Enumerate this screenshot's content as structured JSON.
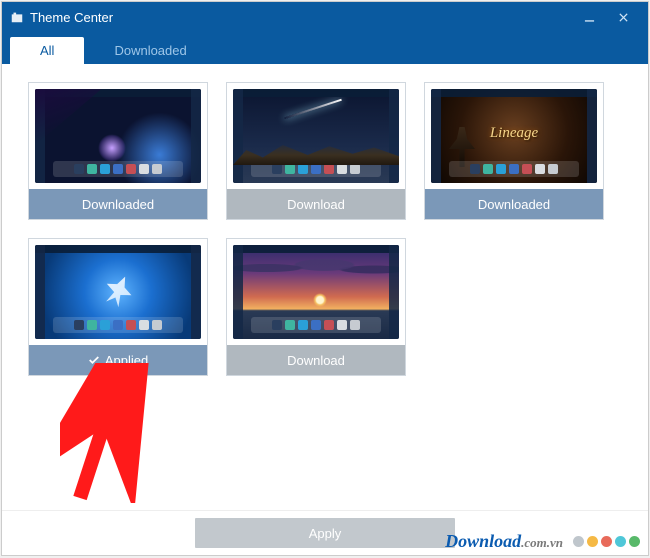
{
  "window": {
    "title": "Theme Center"
  },
  "tabs": {
    "all": "All",
    "downloaded": "Downloaded",
    "active": "all"
  },
  "themes": [
    {
      "status_label": "Downloaded",
      "status_kind": "downloaded",
      "wallpaper": "galaxy"
    },
    {
      "status_label": "Download",
      "status_kind": "download",
      "wallpaper": "comet"
    },
    {
      "status_label": "Downloaded",
      "status_kind": "downloaded",
      "wallpaper": "lineage",
      "logo_text": "Lineage"
    },
    {
      "status_label": "Applied",
      "status_kind": "applied",
      "wallpaper": "feather"
    },
    {
      "status_label": "Download",
      "status_kind": "download",
      "wallpaper": "sunset"
    }
  ],
  "footer": {
    "apply_label": "Apply"
  },
  "watermark": {
    "brand": "Download",
    "ext": ".com.vn"
  }
}
